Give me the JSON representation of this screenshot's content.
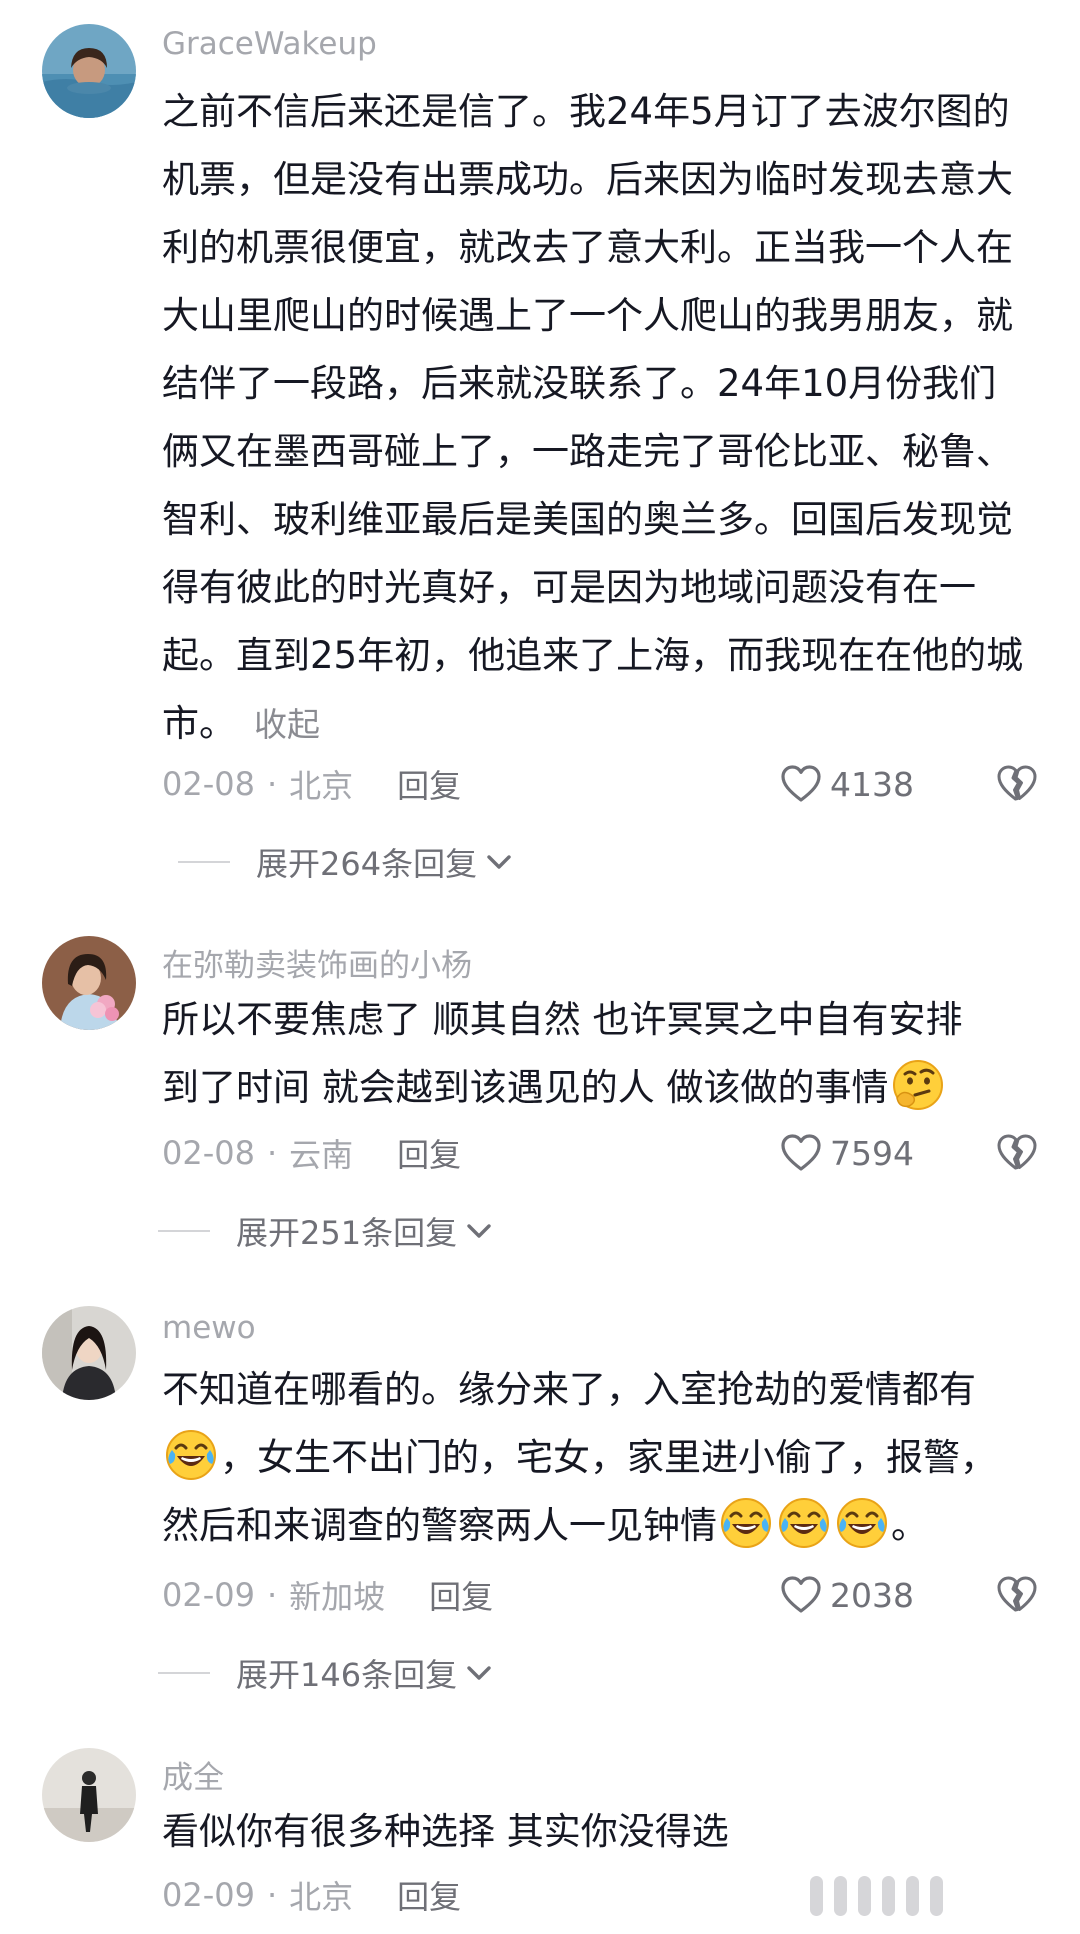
{
  "comments": [
    {
      "username": "GraceWakeup",
      "text": "之前不信后来还是信了。我24年5月订了去波尔图的机票，但是没有出票成功。后来因为临时发现去意大利的机票很便宜，就改去了意大利。正当我一个人在大山里爬山的时候遇上了一个人爬山的我男朋友，就结伴了一段路，后来就没联系了。24年10月份我们俩又在墨西哥碰上了，一路走完了哥伦比亚、秘鲁、智利、玻利维亚最后是美国的奥兰多。回国后发现觉得有彼此的时光真好，可是因为地域问题没有在一起。直到25年初，他追来了上海，而我现在在他的城市。",
      "collapse": "收起",
      "date": "02-08",
      "location": "北京",
      "reply": "回复",
      "likes": "4138",
      "expand_replies": "展开264条回复"
    },
    {
      "username": "在弥勒卖装饰画的小杨",
      "text_line1": "所以不要焦虑了 顺其自然 也许冥冥之中自有安排",
      "text_line2": "到了时间 就会越到该遇见的人 做该做的事情",
      "emoji": "thinking-face",
      "date": "02-08",
      "location": "云南",
      "reply": "回复",
      "likes": "7594",
      "expand_replies": "展开251条回复"
    },
    {
      "username": "mewo",
      "text_line1": "不知道在哪看的。缘分来了，入室抢劫的爱情都有",
      "text_line2": "，女生不出门的，宅女，家里进小偷了，报警，",
      "text_line3": "然后和来调查的警察两人一见钟情",
      "text_end": "。",
      "emoji": "laugh-cry-face",
      "date": "02-09",
      "location": "新加坡",
      "reply": "回复",
      "likes": "2038",
      "expand_replies": "展开146条回复"
    },
    {
      "username": "成全",
      "text": "看似你有很多种选择 其实你没得选",
      "date": "02-09",
      "location": "北京",
      "reply": "回复"
    }
  ],
  "meta_separator": "·",
  "icons": {
    "like": "heart-outline-icon",
    "dislike": "broken-heart-icon",
    "expand": "chevron-down-icon"
  },
  "colors": {
    "text": "#161823",
    "secondary": "#a5a7ad",
    "action": "#6f7077",
    "background": "#ffffff"
  }
}
